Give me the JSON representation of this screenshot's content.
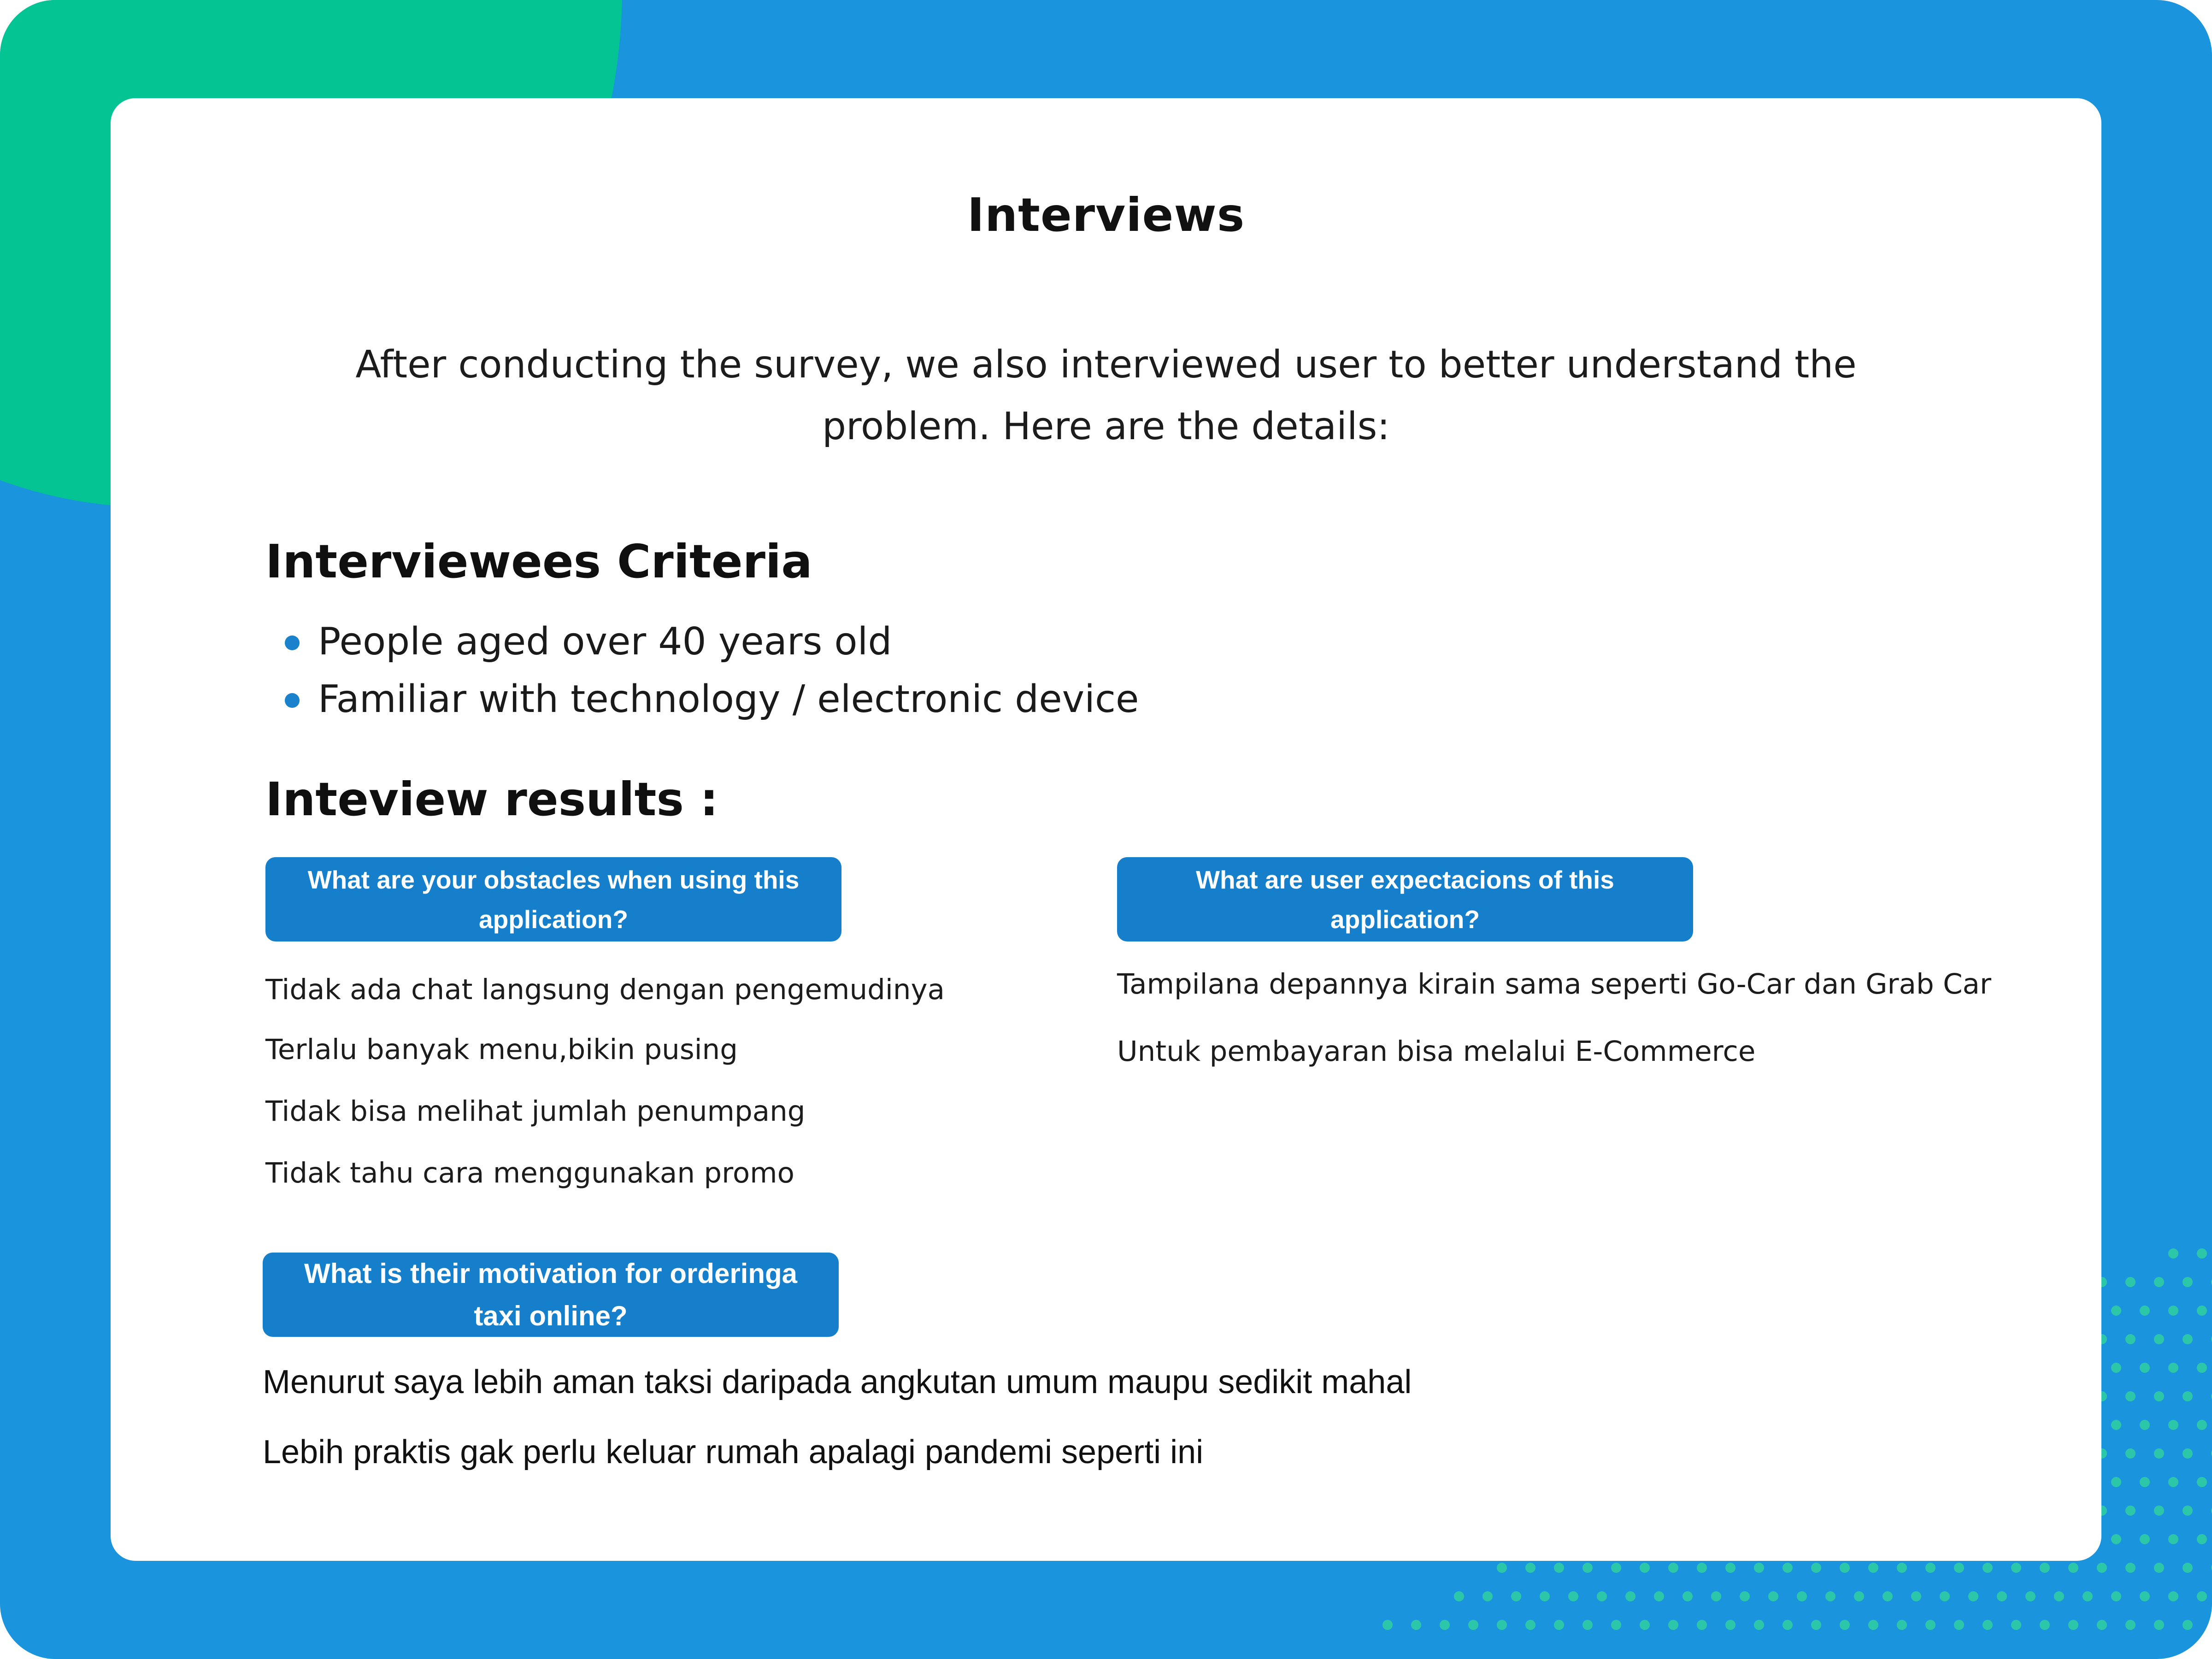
{
  "title": "Interviews",
  "intro": "After conducting the survey, we also interviewed user to better understand the problem. Here are the details:",
  "criteria": {
    "heading": "Interviewees Criteria",
    "items": [
      "People aged over 40 years old",
      "Familiar with technology / electronic device"
    ]
  },
  "results": {
    "heading": "Inteview results :",
    "obstacles": {
      "question": "What are your obstacles when using this application?",
      "answers": [
        "Tidak ada chat langsung dengan pengemudinya",
        "Terlalu banyak menu,bikin pusing",
        "Tidak bisa melihat jumlah penumpang",
        "Tidak tahu cara menggunakan promo"
      ]
    },
    "expectations": {
      "question": "What are user expectacions of this application?",
      "answers": [
        "Tampilana depannya kirain sama seperti Go-Car dan Grab Car",
        "Untuk pembayaran bisa melalui E-Commerce"
      ]
    },
    "motivation": {
      "question": "What is their motivation for orderinga taxi online?",
      "answers": [
        "Menurut saya lebih aman taksi daripada angkutan umum maupu sedikit mahal",
        "Lebih praktis gak perlu keluar rumah apalagi pandemi seperti ini"
      ]
    }
  },
  "colors": {
    "background_blue": "#1b94de",
    "accent_green": "#04c493",
    "pill_blue": "#157fcc",
    "dot_green": "#2fd0a0"
  }
}
